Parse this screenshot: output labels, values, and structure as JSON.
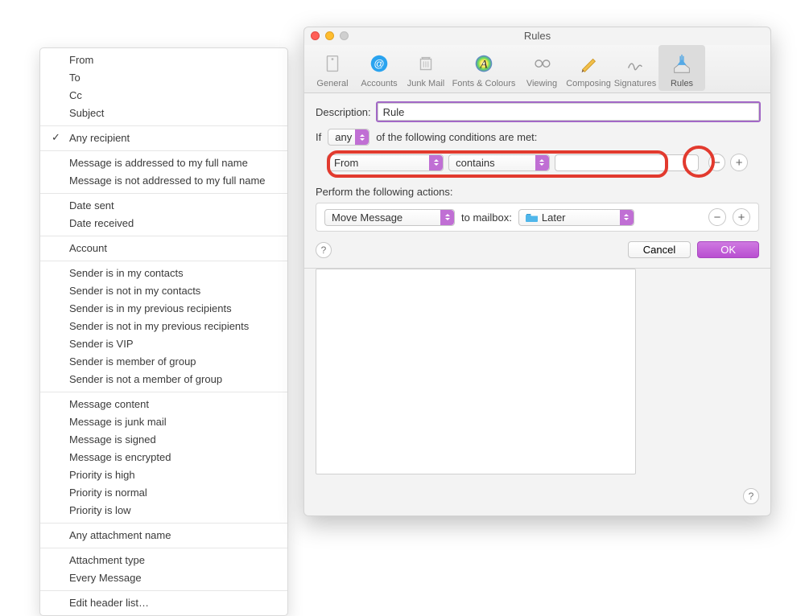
{
  "window": {
    "title": "Rules",
    "toolbar": [
      {
        "id": "general",
        "label": "General"
      },
      {
        "id": "accounts",
        "label": "Accounts"
      },
      {
        "id": "junkmail",
        "label": "Junk Mail"
      },
      {
        "id": "fonts",
        "label": "Fonts & Colours"
      },
      {
        "id": "viewing",
        "label": "Viewing"
      },
      {
        "id": "composing",
        "label": "Composing"
      },
      {
        "id": "signatures",
        "label": "Signatures"
      },
      {
        "id": "rules",
        "label": "Rules",
        "active": true
      }
    ]
  },
  "rule_edit": {
    "description_label": "Description:",
    "description_value": "Rule",
    "if_label": "If",
    "match_mode": "any",
    "if_tail": "of the following conditions are met:",
    "condition": {
      "field": "From",
      "operator": "contains",
      "value": ""
    },
    "actions_label": "Perform the following actions:",
    "action": {
      "verb": "Move Message",
      "to_label": "to mailbox:",
      "mailbox": "Later"
    },
    "cancel_label": "Cancel",
    "ok_label": "OK"
  },
  "dropdown": {
    "groups": [
      {
        "items": [
          {
            "label": "From"
          },
          {
            "label": "To"
          },
          {
            "label": "Cc"
          },
          {
            "label": "Subject"
          }
        ]
      },
      {
        "items": [
          {
            "label": "Any recipient",
            "checked": true
          }
        ]
      },
      {
        "items": [
          {
            "label": "Message is addressed to my full name"
          },
          {
            "label": "Message is not addressed to my full name"
          }
        ]
      },
      {
        "items": [
          {
            "label": "Date sent"
          },
          {
            "label": "Date received"
          }
        ]
      },
      {
        "items": [
          {
            "label": "Account"
          }
        ]
      },
      {
        "items": [
          {
            "label": "Sender is in my contacts"
          },
          {
            "label": "Sender is not in my contacts"
          },
          {
            "label": "Sender is in my previous recipients"
          },
          {
            "label": "Sender is not in my previous recipients"
          },
          {
            "label": "Sender is VIP"
          },
          {
            "label": "Sender is member of group"
          },
          {
            "label": "Sender is not a member of group"
          }
        ]
      },
      {
        "items": [
          {
            "label": "Message content"
          },
          {
            "label": "Message is junk mail"
          },
          {
            "label": "Message is signed"
          },
          {
            "label": "Message is encrypted"
          },
          {
            "label": "Priority is high"
          },
          {
            "label": "Priority is normal"
          },
          {
            "label": "Priority is low"
          }
        ]
      },
      {
        "items": [
          {
            "label": "Any attachment name"
          }
        ]
      },
      {
        "items": [
          {
            "label": "Attachment type"
          },
          {
            "label": "Every Message"
          }
        ]
      },
      {
        "items": [
          {
            "label": "Edit header list…"
          }
        ]
      }
    ]
  }
}
